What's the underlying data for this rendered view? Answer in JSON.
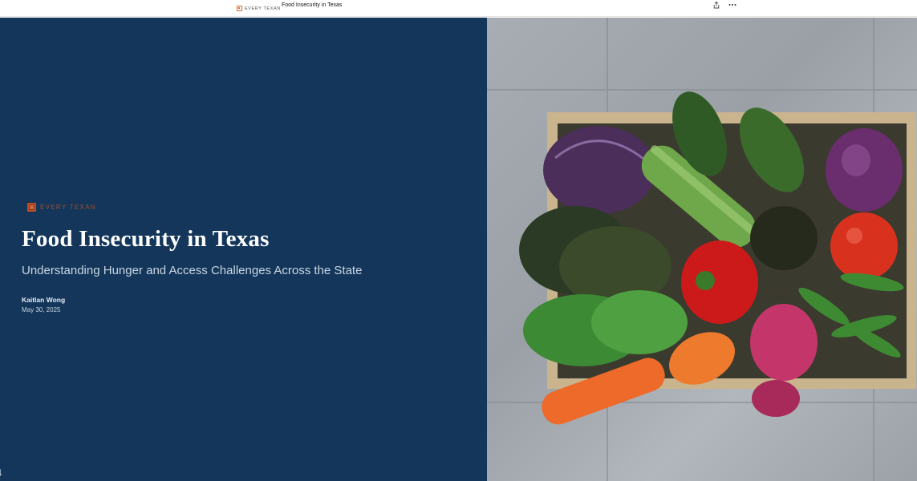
{
  "topbar": {
    "brand": "EVERY TEXAN",
    "title": "Food Insecurity in Texas",
    "share_icon": "share-icon",
    "more_icon": "more-options-icon"
  },
  "hero": {
    "brand": "EVERY TEXAN",
    "title": "Food Insecurity in Texas",
    "subtitle": "Understanding Hunger and Access Challenges Across the State",
    "author": "Kaitlan Wong",
    "date": "May 30, 2025",
    "scroll_icon": "scroll-down-arrow-icon"
  },
  "photo": {
    "subject": "vegetable-crate-image"
  },
  "colors": {
    "hero_bg": "#13365a",
    "brand_accent": "#d9622b"
  }
}
